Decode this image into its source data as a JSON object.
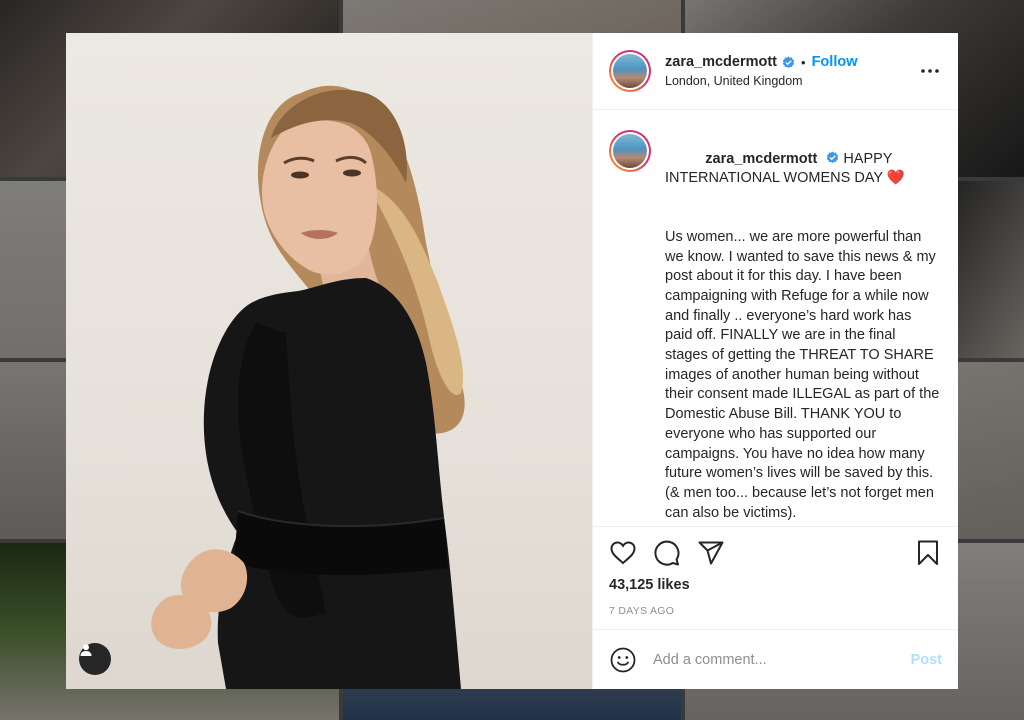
{
  "post": {
    "username": "zara_mcdermott",
    "follow_label": "Follow",
    "separator": "•",
    "location": "London, United Kingdom",
    "caption_headline": "HAPPY INTERNATIONAL WOMENS DAY",
    "caption_emoji": "❤️",
    "caption_body": "Us women... we are more powerful than we know. I wanted to save this news & my post about it for this day. I have been campaigning with Refuge for a while now and finally .. everyone’s hard work has paid off. FINALLY we are in the final stages of getting the THREAT TO SHARE images of another human being without their consent made ILLEGAL as part of the Domestic Abuse Bill. THANK YOU to everyone who has supported our campaigns. You have no idea how many future women’s lives will be saved by this. (& men too... because let’s not forget men can also be victims).",
    "likes": "43,125 likes",
    "posted": "7 DAYS AGO"
  },
  "comment": {
    "placeholder": "Add a comment...",
    "post_label": "Post"
  },
  "icons": {
    "verified": "verified-badge-icon",
    "more": "more-options-icon",
    "like": "heart-icon",
    "comment": "comment-icon",
    "share": "paper-plane-icon",
    "save": "bookmark-icon",
    "emoji": "smiley-icon",
    "tags": "user-tag-icon"
  },
  "colors": {
    "accent": "#0095f6",
    "post_disabled": "#b2dffc",
    "muted": "#8e8e8e",
    "text": "#262626"
  }
}
